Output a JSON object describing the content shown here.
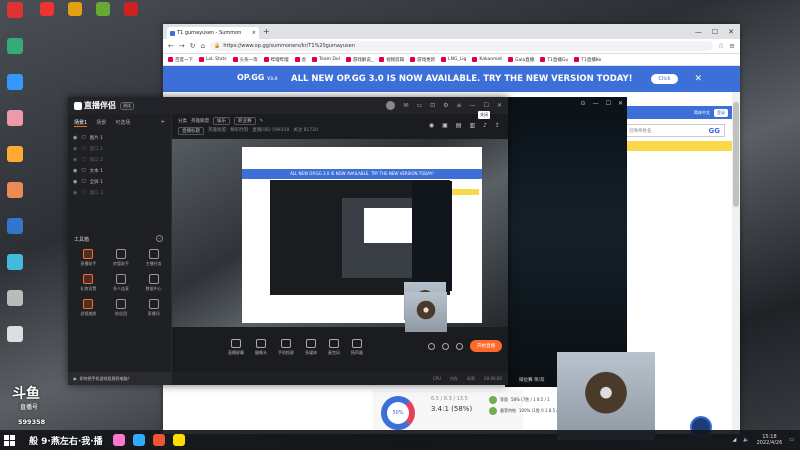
{
  "colors": {
    "opgg_blue": "#3d6fd8",
    "accent_orange": "#ff6a2a",
    "op_yellow": "#f9d94a",
    "app_bg": "#1b1c20"
  },
  "desktop": {
    "left_icons": [
      {
        "label": "",
        "color": "#d33",
        "icon": "app-icon"
      },
      {
        "label": "",
        "color": "#3a7",
        "icon": "app-icon"
      },
      {
        "label": "",
        "color": "#39f",
        "icon": "app-icon"
      },
      {
        "label": "",
        "color": "#e9a",
        "icon": "app-icon"
      },
      {
        "label": "",
        "color": "#fa3",
        "icon": "app-icon"
      },
      {
        "label": "",
        "color": "#e85",
        "icon": "app-icon"
      },
      {
        "label": "",
        "color": "#37c",
        "icon": "app-icon"
      },
      {
        "label": "",
        "color": "#4bd",
        "icon": "app-icon"
      },
      {
        "label": "",
        "color": "#bbb",
        "icon": "app-icon"
      },
      {
        "label": "",
        "color": "#ddd",
        "icon": "app-icon"
      }
    ],
    "top_icons": [
      "#e33",
      "#e3a010",
      "#6a3",
      "#c22"
    ]
  },
  "browser": {
    "tab_title": "T1 gumayusen - Summon",
    "url": "https://www.op.gg/summoners/kr/T1%20gumayusen",
    "bookmarks": [
      "百度一下",
      "LoL Stats",
      "头条一等",
      "哔哩哔哩",
      "虎",
      "Team Dol",
      "游戏解说_",
      "视频剪辑",
      "游戏更新",
      "LNG_Lig",
      "Kakaomet",
      "Gala直播",
      "T1直播Gu",
      "T1直播Ke"
    ],
    "banner": {
      "logo": "OP.GG",
      "logo_version": "V3.0",
      "message": "ALL NEW OP.GG 3.0 IS NOW AVAILABLE. TRY THE NEW VERSION TODAY!",
      "button": "Click"
    },
    "nav": {
      "lang": "简体中文",
      "login": "登录"
    },
    "search_placeholder": "召唤师姓名",
    "search_logo": "GG",
    "stats": {
      "winrate": "50%",
      "kda_small": "6.5 / 8.3 / 13.5",
      "kda_big": "3.4:1 (58%)",
      "champs": [
        {
          "name": "菲奥",
          "detail": "58% (7胜 / 1 8.5 / 1"
        },
        {
          "name": "墨菲特帕",
          "detail": "100% (1胜 0 1 8.5 / 1"
        }
      ]
    }
  },
  "viewer": {
    "title_hint": "直播",
    "bottom": "排位赛 单/双"
  },
  "app": {
    "logo": "直播伴侣",
    "version": "测试",
    "close_hint": "关闭",
    "tabs": [
      "场景1",
      "场景",
      "可选场"
    ],
    "sources": [
      {
        "name": "图片 1",
        "dim": false
      },
      {
        "name": "窗口 1",
        "dim": true
      },
      {
        "name": "窗口 2",
        "dim": true
      },
      {
        "name": "文本 1",
        "dim": false
      },
      {
        "name": "全屏 1",
        "dim": false
      },
      {
        "name": "窗口 3",
        "dim": true
      }
    ],
    "tools_title": "工具箱",
    "tools": [
      {
        "label": "直播助手",
        "orange": true
      },
      {
        "label": "房管助手",
        "orange": false
      },
      {
        "label": "主播任务",
        "orange": false
      },
      {
        "label": "礼物设置",
        "orange": true
      },
      {
        "label": "多人连麦",
        "orange": false
      },
      {
        "label": "数据中心",
        "orange": false
      },
      {
        "label": "滤镜美颜",
        "orange": true
      },
      {
        "label": "粉丝团",
        "orange": false
      },
      {
        "label": "直播间",
        "orange": false
      }
    ],
    "footer_hint": "如何把手机游戏投屏到电脑？",
    "top": {
      "category_label": "分类",
      "category_value": "英雄联盟",
      "pill1": "娱乐",
      "pill2": "职业赛",
      "row2_label": "直播标题",
      "row2_value": "英雄联盟 · 精彩时刻",
      "row2_extra": "直播间ID 599358",
      "row2_count": "关注 81720"
    },
    "toolbar": [
      {
        "label": "直播屏幕"
      },
      {
        "label": "摄像头"
      },
      {
        "label": "手机投屏"
      },
      {
        "label": "多媒体"
      },
      {
        "label": "麦克风"
      },
      {
        "label": "扬声器"
      }
    ],
    "live_button": "开始直播",
    "status": [
      "CPU",
      "内存",
      "码率",
      "00:00:00"
    ]
  },
  "overlays": {
    "stream_big": "斗鱼",
    "tag": "直播号",
    "room_number": "599358",
    "scroll_text": "般 9·燕左右·我·播"
  },
  "taskbar": {
    "time": "15:18",
    "date": "2022/4/26",
    "apps": [
      "#f7c",
      "#3af",
      "#e53",
      "#fd0"
    ]
  }
}
